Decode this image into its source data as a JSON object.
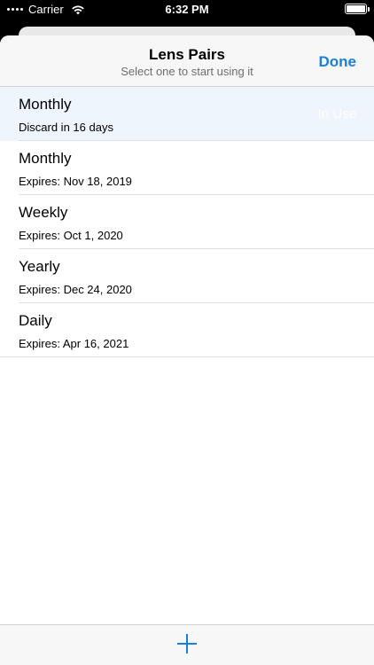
{
  "status_bar": {
    "carrier": "Carrier",
    "time": "6:32 PM"
  },
  "header": {
    "title": "Lens Pairs",
    "subtitle": "Select one to start using it",
    "done_label": "Done"
  },
  "lens_pairs": [
    {
      "name": "Monthly",
      "detail": "Discard in 16 days",
      "badge": "In Use"
    },
    {
      "name": "Monthly",
      "detail": "Expires: Nov 18, 2019"
    },
    {
      "name": "Weekly",
      "detail": "Expires: Oct 1, 2020"
    },
    {
      "name": "Yearly",
      "detail": "Expires: Dec 24, 2020"
    },
    {
      "name": "Daily",
      "detail": "Expires: Apr 16, 2021"
    }
  ],
  "toolbar": {
    "add_icon": "plus-icon"
  },
  "colors": {
    "accent": "#1a7fd6",
    "selected_row": "#eef5fd"
  }
}
